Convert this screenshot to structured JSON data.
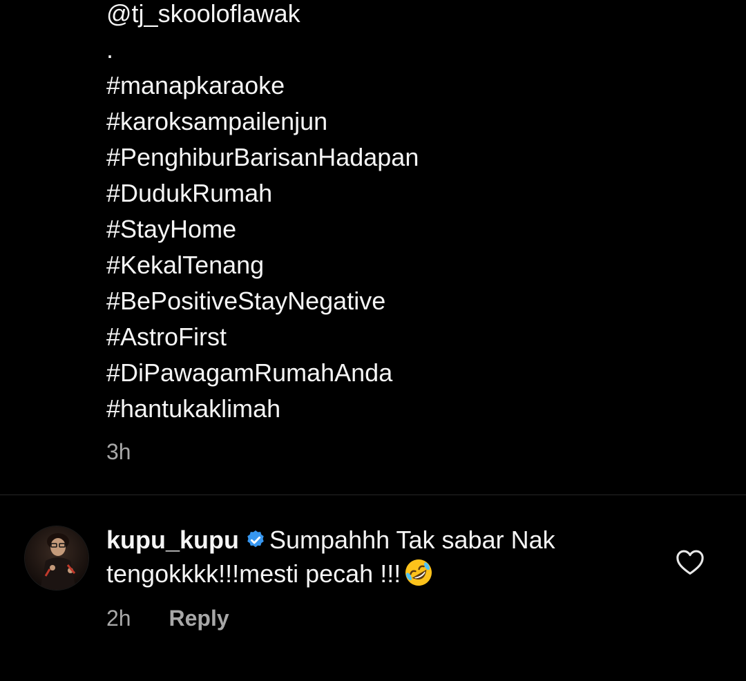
{
  "caption": {
    "lines": [
      "@tj_skooloflawak",
      ".",
      "#manapkaraoke",
      "#karoksampailenjun",
      "#PenghiburBarisanHadapan",
      "#DudukRumah",
      "#StayHome",
      "#KekalTenang",
      "#BePositiveStayNegative",
      "#AstroFirst",
      "#DiPawagamRumahAnda",
      "#hantukaklimah"
    ],
    "time": "3h"
  },
  "comment": {
    "username": "kupu_kupu",
    "verified_icon": "verified-badge-icon",
    "verified_color": "#3797f0",
    "text": "Sumpahhh Tak sabar Nak tengokkkk!!!mesti pecah !!!",
    "emoji": "rolling-on-the-floor-laughing-emoji",
    "time": "2h",
    "reply_label": "Reply",
    "like_icon": "heart-outline-icon"
  },
  "colors": {
    "background": "#000000",
    "text_primary": "#f5f5f5",
    "text_secondary": "#a8a8a8",
    "divider": "#262626"
  }
}
